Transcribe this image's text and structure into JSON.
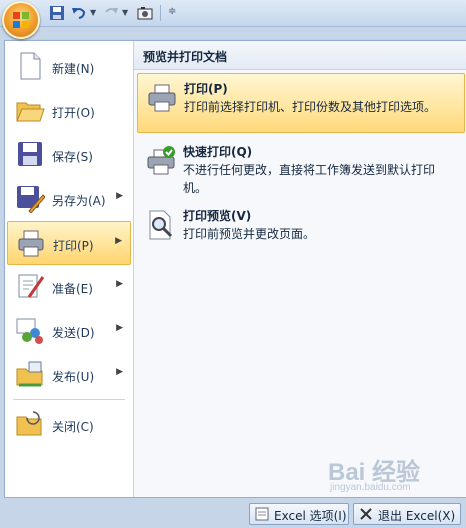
{
  "qat": {
    "icons": [
      "office-logo-icon",
      "save-icon",
      "undo-icon",
      "redo-icon",
      "camera-icon",
      "customize-icon"
    ]
  },
  "left_menu": {
    "items": [
      {
        "label": "新建(N)",
        "icon": "new-document-icon",
        "has_submenu": false
      },
      {
        "label": "打开(O)",
        "icon": "open-folder-icon",
        "has_submenu": false
      },
      {
        "label": "保存(S)",
        "icon": "save-disk-icon",
        "has_submenu": false
      },
      {
        "label": "另存为(A)",
        "icon": "save-as-icon",
        "has_submenu": true
      },
      {
        "label": "打印(P)",
        "icon": "printer-icon",
        "has_submenu": true,
        "active": true
      },
      {
        "label": "准备(E)",
        "icon": "prepare-icon",
        "has_submenu": true
      },
      {
        "label": "发送(D)",
        "icon": "send-icon",
        "has_submenu": true
      },
      {
        "label": "发布(U)",
        "icon": "publish-icon",
        "has_submenu": true
      },
      {
        "label": "关闭(C)",
        "icon": "close-folder-icon",
        "has_submenu": false
      }
    ]
  },
  "right_panel": {
    "title": "预览并打印文档",
    "options": [
      {
        "title": "打印(P)",
        "desc": "打印前选择打印机、打印份数及其他打印选项。",
        "icon": "printer-icon"
      },
      {
        "title": "快速打印(Q)",
        "desc": "不进行任何更改，直接将工作簿发送到默认打印机。",
        "icon": "quick-print-icon"
      },
      {
        "title": "打印预览(V)",
        "desc": "打印前预览并更改页面。",
        "icon": "print-preview-icon"
      }
    ]
  },
  "bottom": {
    "options_label": "Excel 选项(I)",
    "exit_label": "退出 Excel(X)"
  },
  "watermark": {
    "brand": "Bai 经验",
    "url": "jingyan.baidu.com"
  },
  "colors": {
    "highlight": "#ffd56e",
    "border": "#94aed4"
  }
}
